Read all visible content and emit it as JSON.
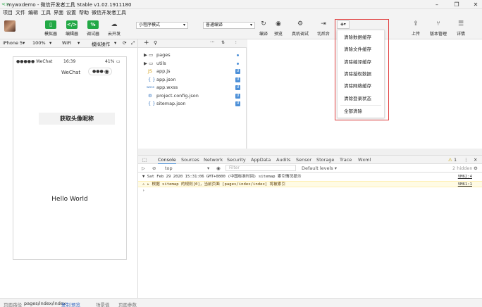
{
  "window": {
    "title": "mywxdemo - 微信开发者工具 Stable v1.02.1911180",
    "logo": "<>"
  },
  "menu": [
    "项目",
    "文件",
    "编辑",
    "工具",
    "界面",
    "设置",
    "帮助",
    "微信开发者工具"
  ],
  "toolbar": {
    "left_buttons": [
      {
        "label": "模拟器",
        "icon": "▯",
        "icon_name": "simulator-icon"
      },
      {
        "label": "编辑器",
        "icon": "</>",
        "icon_name": "editor-icon"
      },
      {
        "label": "调试器",
        "icon": "%",
        "icon_name": "debugger-icon"
      },
      {
        "label": "云开发",
        "icon": "☁",
        "icon_name": "cloud-icon"
      }
    ],
    "mode_select": "小程序模式",
    "compile_select": "普通编译",
    "mid_buttons": [
      {
        "label": "编译",
        "icon": "↻",
        "icon_name": "compile-icon"
      },
      {
        "label": "预览",
        "icon": "◉",
        "icon_name": "preview-icon"
      },
      {
        "label": "真机调试",
        "icon": "⚙",
        "icon_name": "real-device-debug-icon"
      },
      {
        "label": "切后台",
        "icon": "⇥",
        "icon_name": "background-icon"
      }
    ],
    "right_buttons": [
      {
        "label": "上传",
        "icon": "⇪",
        "icon_name": "upload-icon"
      },
      {
        "label": "版本管理",
        "icon": "⑂",
        "icon_name": "version-control-icon"
      },
      {
        "label": "详情",
        "icon": "☰",
        "icon_name": "details-icon"
      }
    ]
  },
  "cache_dropdown": {
    "trigger": "◈▾",
    "items": [
      "清除数据缓存",
      "清除文件缓存",
      "清除编译缓存",
      "清除授权数据",
      "清除网络缓存",
      "清除登录状态"
    ],
    "all": "全部清除",
    "outline_color": "#e04040"
  },
  "simulator_bar": {
    "device": "iPhone 5",
    "zoom": "100%",
    "network": "WiFi",
    "ops": "模拟操作"
  },
  "phone": {
    "carrier": "●●●●● WeChat",
    "time": "16:39",
    "battery": "41%",
    "nav_title": "WeChat",
    "get_button": "获取头像昵称",
    "hello": "Hello World"
  },
  "explorer": {
    "files": [
      {
        "name": "pages",
        "type": "folder",
        "icon": "▶ ▭"
      },
      {
        "name": "utils",
        "type": "folder",
        "icon": "▶ ▭"
      },
      {
        "name": "app.js",
        "type": "js",
        "icon": "JS",
        "badge": "U"
      },
      {
        "name": "app.json",
        "type": "json",
        "icon": "{ }",
        "badge": "U"
      },
      {
        "name": "app.wxss",
        "type": "wxss",
        "icon": "wxss",
        "badge": "U"
      },
      {
        "name": "project.config.json",
        "type": "json",
        "icon": "⚙",
        "badge": "U"
      },
      {
        "name": "sitemap.json",
        "type": "json",
        "icon": "{ }",
        "badge": "U"
      }
    ]
  },
  "devtools": {
    "tabs": [
      "Console",
      "Sources",
      "Network",
      "Security",
      "AppData",
      "Audits",
      "Sensor",
      "Storage",
      "Trace",
      "Wxml"
    ],
    "active_tab": "Console",
    "warnings_count": "1",
    "filter_context": "top",
    "filter_placeholder": "Filter",
    "levels": "Default levels ▾",
    "hidden": "2 hidden",
    "lines": [
      {
        "text": "▼ Sat Feb 29 2020 15:31:06 GMT+0800 (中国标准时间) sitemap 索引情况提示",
        "src": "VM62:4",
        "kind": "group"
      },
      {
        "text": "  ⚠ ▸ 根据 sitemap 的规则[0]，当前页面 [pages/index/index] 将被索引",
        "src": "VM61:1",
        "kind": "warn"
      },
      {
        "text": "›",
        "src": "",
        "kind": "prompt"
      }
    ]
  },
  "statusline": {
    "path_label": "页面路径",
    "path": "pages/index/index",
    "copy": "复制",
    "preview": "预览",
    "scene": "场景值",
    "params": "页面参数"
  }
}
